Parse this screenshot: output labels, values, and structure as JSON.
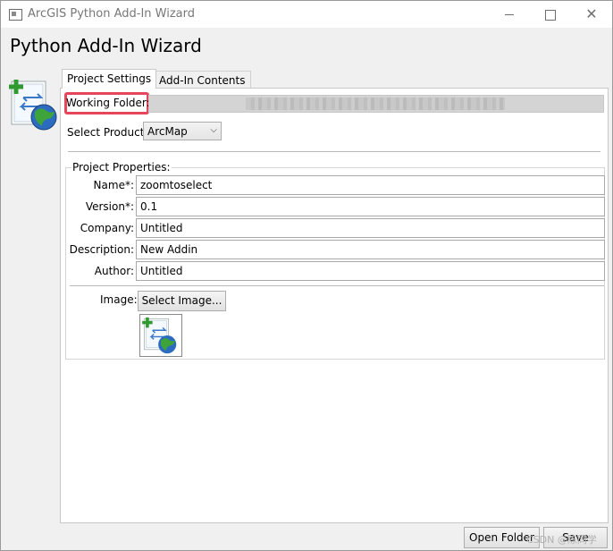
{
  "window": {
    "title": "ArcGIS Python Add-In Wizard",
    "minimize_icon": "minimize-icon",
    "maximize_icon": "maximize-icon",
    "close_icon": "close-icon",
    "close_glyph": "✕"
  },
  "header": {
    "title": "Python Add-In Wizard",
    "icon": "addin-wizard-icon"
  },
  "tabs": [
    {
      "label": "Project Settings",
      "active": true
    },
    {
      "label": "Add-In Contents",
      "active": false
    }
  ],
  "working_folder": {
    "label": "Working Folder:",
    "value_redacted": true,
    "highlight_color": "#e5465b"
  },
  "product": {
    "label": "Select Product:",
    "selected": "ArcMap",
    "arrow_glyph": "⌵"
  },
  "project_properties": {
    "group_label": "Project Properties:",
    "fields": [
      {
        "label": "Name*:",
        "value": "zoomtoselect"
      },
      {
        "label": "Version*:",
        "value": "0.1"
      },
      {
        "label": "Company:",
        "value": "Untitled"
      },
      {
        "label": "Description:",
        "value": "New Addin"
      },
      {
        "label": "Author:",
        "value": "Untitled"
      }
    ],
    "image_label": "Image:",
    "select_image_button": "Select Image..."
  },
  "footer": {
    "open_folder_button": "Open Folder",
    "save_button": "Save",
    "watermark": "CSDN @陈同学"
  },
  "colors": {
    "accent_highlight": "#e5465b",
    "window_bg": "#f0f0f0",
    "content_bg": "#ffffff"
  }
}
